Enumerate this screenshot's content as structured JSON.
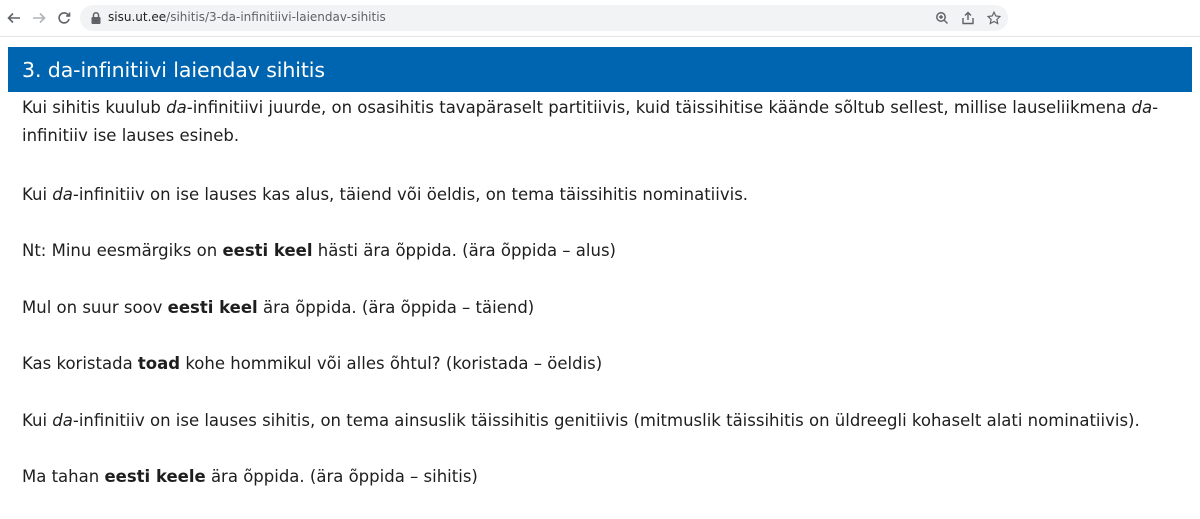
{
  "browser": {
    "back_icon": "arrow-left-icon",
    "forward_icon": "arrow-right-icon",
    "reload_icon": "reload-icon",
    "url_host": "sisu.ut.ee",
    "url_path": "/sihitis/3-da-infinitiivi-laiendav-sihitis",
    "zoom_icon": "zoom-icon",
    "share_icon": "share-icon",
    "bookmark_icon": "star-icon"
  },
  "article": {
    "title": "3. da-infinitiivi laiendav sihitis",
    "heading_color": "#0065b0",
    "p1": {
      "a": "Kui sihitis kuulub ",
      "b": "da",
      "c": "-infinitiivi juurde, on osasihitis tavapäraselt partitiivis, kuid täissihitise käände sõltub sellest, millise lauseliikmena ",
      "d": "da",
      "e": "-",
      "f": "infinitiiv ise lauses esineb."
    },
    "p2": {
      "a": "Kui ",
      "b": "da",
      "c": "-infinitiiv on ise lauses kas alus, täiend või öeldis, on tema täissihitis nominatiivis."
    },
    "p3": {
      "a": "Nt: Minu eesmärgiks on ",
      "b": "eesti keel",
      "c": " hästi ära õppida. (ära õppida – alus)"
    },
    "p4": {
      "a": "Mul on suur soov ",
      "b": "eesti keel",
      "c": " ära õppida. (ära õppida – täiend)"
    },
    "p5": {
      "a": "Kas koristada ",
      "b": "toad",
      "c": " kohe hommikul või alles õhtul? (koristada – öeldis)"
    },
    "p6": {
      "a": "Kui ",
      "b": "da",
      "c": "-infinitiiv on ise lauses sihitis, on tema ainsuslik täissihitis genitiivis (mitmuslik täissihitis on üldreegli kohaselt alati nominatiivis)."
    },
    "p7": {
      "a": "Ma tahan ",
      "b": "eesti keele",
      "c": " ära õppida. (ära õppida – sihitis)"
    }
  }
}
